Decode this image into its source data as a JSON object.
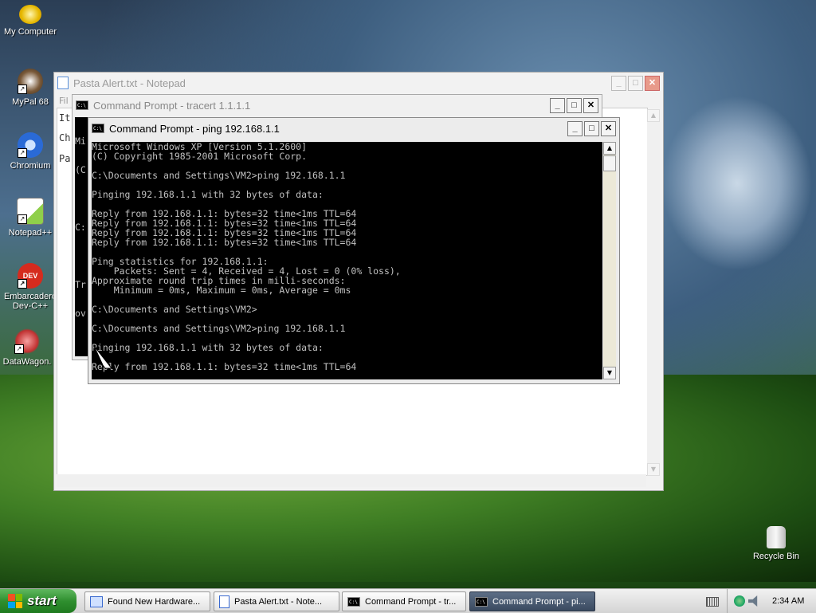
{
  "desktop": {
    "icons": [
      {
        "label": "My Computer",
        "icon": "my-computer-icon"
      },
      {
        "label": "MyPal 68",
        "icon": "mypal-icon"
      },
      {
        "label": "Chromium",
        "icon": "chromium-icon"
      },
      {
        "label": "Notepad++",
        "icon": "notepad-plus-plus-icon"
      },
      {
        "label": "Embarcadero Dev-C++",
        "icon": "devcpp-icon"
      },
      {
        "label": "DataWagon.",
        "icon": "datawagon-icon"
      },
      {
        "label": "Recycle Bin",
        "icon": "recycle-bin-icon"
      }
    ]
  },
  "notepad": {
    "title": "Pasta Alert.txt - Notepad",
    "menu_partial": "Fil",
    "text_fragments": [
      "It",
      "Ch",
      "Pa"
    ]
  },
  "tracert": {
    "title": "Command Prompt - tracert 1.1.1.1",
    "text_fragments": [
      "Mi",
      "(C",
      "C:",
      "Tr",
      "ov"
    ]
  },
  "ping": {
    "title": "Command Prompt - ping 192.168.1.1",
    "console_lines": [
      "Microsoft Windows XP [Version 5.1.2600]",
      "(C) Copyright 1985-2001 Microsoft Corp.",
      "",
      "C:\\Documents and Settings\\VM2>ping 192.168.1.1",
      "",
      "Pinging 192.168.1.1 with 32 bytes of data:",
      "",
      "Reply from 192.168.1.1: bytes=32 time<1ms TTL=64",
      "Reply from 192.168.1.1: bytes=32 time<1ms TTL=64",
      "Reply from 192.168.1.1: bytes=32 time<1ms TTL=64",
      "Reply from 192.168.1.1: bytes=32 time<1ms TTL=64",
      "",
      "Ping statistics for 192.168.1.1:",
      "    Packets: Sent = 4, Received = 4, Lost = 0 (0% loss),",
      "Approximate round trip times in milli-seconds:",
      "    Minimum = 0ms, Maximum = 0ms, Average = 0ms",
      "",
      "C:\\Documents and Settings\\VM2>",
      "",
      "C:\\Documents and Settings\\VM2>ping 192.168.1.1",
      "",
      "Pinging 192.168.1.1 with 32 bytes of data:",
      "",
      "Reply from 192.168.1.1: bytes=32 time<1ms TTL=64"
    ]
  },
  "taskbar": {
    "start_label": "start",
    "tasks": [
      {
        "label": "Found New Hardware...",
        "icon": "hardware-icon",
        "active": false
      },
      {
        "label": "Pasta Alert.txt - Note...",
        "icon": "notepad-icon",
        "active": false
      },
      {
        "label": "Command Prompt - tr...",
        "icon": "cmd-icon",
        "active": false
      },
      {
        "label": "Command Prompt - pi...",
        "icon": "cmd-icon",
        "active": true
      }
    ],
    "clock": "2:34 AM"
  },
  "colors": {
    "console_bg": "#000000",
    "console_fg": "#c0c0c0",
    "taskbar_active": "#3a4a60"
  }
}
